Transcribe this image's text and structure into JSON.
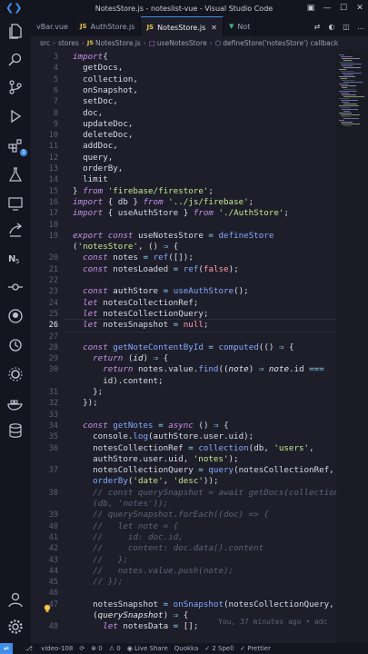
{
  "window": {
    "title": "NotesStore.js - noteslist-vue - Visual Studio Code"
  },
  "activity": {
    "source_control_badge": "1"
  },
  "tabs": [
    {
      "label": "vBar.vue",
      "active": false
    },
    {
      "label": "AuthStore.js",
      "active": false
    },
    {
      "label": "NotesStore.js",
      "active": true
    },
    {
      "label": "Not",
      "active": false
    }
  ],
  "breadcrumb": [
    "src",
    "stores",
    "NotesStore.js",
    "useNotesStore",
    "defineStore('notesStore') callback"
  ],
  "editor": {
    "current_line": 26,
    "lines": [
      {
        "n": "3",
        "segs": [
          [
            "kw",
            "import"
          ],
          [
            "",
            "{"
          ]
        ]
      },
      {
        "n": "4",
        "segs": [
          [
            "",
            "  getDocs,"
          ]
        ]
      },
      {
        "n": "5",
        "segs": [
          [
            "",
            "  collection,"
          ]
        ]
      },
      {
        "n": "6",
        "segs": [
          [
            "",
            "  onSnapshot,"
          ]
        ]
      },
      {
        "n": "7",
        "segs": [
          [
            "",
            "  setDoc,"
          ]
        ]
      },
      {
        "n": "8",
        "segs": [
          [
            "",
            "  doc,"
          ]
        ]
      },
      {
        "n": "9",
        "segs": [
          [
            "",
            "  updateDoc,"
          ]
        ]
      },
      {
        "n": "10",
        "segs": [
          [
            "",
            "  deleteDoc,"
          ]
        ]
      },
      {
        "n": "11",
        "segs": [
          [
            "",
            "  addDoc,"
          ]
        ]
      },
      {
        "n": "12",
        "segs": [
          [
            "",
            "  query,"
          ]
        ]
      },
      {
        "n": "13",
        "segs": [
          [
            "",
            "  orderBy,"
          ]
        ]
      },
      {
        "n": "14",
        "segs": [
          [
            "",
            "  limit"
          ]
        ]
      },
      {
        "n": "15",
        "segs": [
          [
            "",
            "} "
          ],
          [
            "kw",
            "from"
          ],
          [
            "",
            " "
          ],
          [
            "str",
            "'firebase/firestore'"
          ],
          [
            "",
            ";"
          ]
        ]
      },
      {
        "n": "16",
        "segs": [
          [
            "kw",
            "import"
          ],
          [
            "",
            " { db } "
          ],
          [
            "kw",
            "from"
          ],
          [
            "",
            " "
          ],
          [
            "str",
            "'../js/firebase'"
          ],
          [
            "",
            ";"
          ]
        ]
      },
      {
        "n": "17",
        "segs": [
          [
            "kw",
            "import"
          ],
          [
            "",
            " { useAuthStore } "
          ],
          [
            "kw",
            "from"
          ],
          [
            "",
            " "
          ],
          [
            "str",
            "'./AuthStore'"
          ],
          [
            "",
            ";"
          ]
        ]
      },
      {
        "n": "18",
        "segs": []
      },
      {
        "n": "19",
        "segs": [
          [
            "kw",
            "export"
          ],
          [
            "",
            " "
          ],
          [
            "kw",
            "const"
          ],
          [
            "",
            " useNotesStore "
          ],
          [
            "op",
            "="
          ],
          [
            "",
            " "
          ],
          [
            "fn",
            "defineStore"
          ]
        ]
      },
      {
        "n": "",
        "segs": [
          [
            "",
            "("
          ],
          [
            "str",
            "'notesStore'"
          ],
          [
            "",
            ", () "
          ],
          [
            "op",
            "⇒"
          ],
          [
            "",
            " {"
          ]
        ]
      },
      {
        "n": "20",
        "segs": [
          [
            "",
            "  "
          ],
          [
            "kw",
            "const"
          ],
          [
            "",
            " notes "
          ],
          [
            "op",
            "="
          ],
          [
            "",
            " "
          ],
          [
            "fn",
            "ref"
          ],
          [
            "",
            "([]);"
          ]
        ]
      },
      {
        "n": "21",
        "segs": [
          [
            "",
            "  "
          ],
          [
            "kw",
            "const"
          ],
          [
            "",
            " notesLoaded "
          ],
          [
            "op",
            "="
          ],
          [
            "",
            " "
          ],
          [
            "fn",
            "ref"
          ],
          [
            "",
            "("
          ],
          [
            "con",
            "false"
          ],
          [
            "",
            ");"
          ]
        ]
      },
      {
        "n": "22",
        "segs": []
      },
      {
        "n": "23",
        "segs": [
          [
            "",
            "  "
          ],
          [
            "kw",
            "const"
          ],
          [
            "",
            " authStore "
          ],
          [
            "op",
            "="
          ],
          [
            "",
            " "
          ],
          [
            "fn",
            "useAuthStore"
          ],
          [
            "",
            "();"
          ]
        ]
      },
      {
        "n": "24",
        "segs": [
          [
            "",
            "  "
          ],
          [
            "kw",
            "let"
          ],
          [
            "",
            " notesCollectionRef;"
          ]
        ]
      },
      {
        "n": "25",
        "segs": [
          [
            "",
            "  "
          ],
          [
            "kw",
            "let"
          ],
          [
            "",
            " notesCollectionQuery;"
          ]
        ]
      },
      {
        "n": "26",
        "segs": [
          [
            "",
            "  "
          ],
          [
            "kw",
            "let"
          ],
          [
            "",
            " notesSnapshot "
          ],
          [
            "op",
            "="
          ],
          [
            "",
            " "
          ],
          [
            "con",
            "null"
          ],
          [
            "",
            ";"
          ]
        ]
      },
      {
        "n": "27",
        "segs": []
      },
      {
        "n": "28",
        "segs": [
          [
            "",
            "  "
          ],
          [
            "kw",
            "const"
          ],
          [
            "",
            " "
          ],
          [
            "fn",
            "getNoteContentById"
          ],
          [
            "",
            " "
          ],
          [
            "op",
            "="
          ],
          [
            "",
            " "
          ],
          [
            "fn",
            "computed"
          ],
          [
            "",
            "(() "
          ],
          [
            "op",
            "⇒"
          ],
          [
            "",
            " {"
          ]
        ]
      },
      {
        "n": "29",
        "segs": [
          [
            "",
            "    "
          ],
          [
            "ctl",
            "return"
          ],
          [
            "",
            " ("
          ],
          [
            "prm",
            "id"
          ],
          [
            "",
            ") "
          ],
          [
            "op",
            "⇒"
          ],
          [
            "",
            " {"
          ]
        ]
      },
      {
        "n": "30",
        "segs": [
          [
            "",
            "      "
          ],
          [
            "ctl",
            "return"
          ],
          [
            "",
            " notes.value."
          ],
          [
            "fn",
            "find"
          ],
          [
            "",
            "(("
          ],
          [
            "prm",
            "note"
          ],
          [
            "",
            ") "
          ],
          [
            "op",
            "⇒"
          ],
          [
            "",
            " "
          ],
          [
            "prm",
            "note"
          ],
          [
            "",
            ".id "
          ],
          [
            "op",
            "==="
          ]
        ]
      },
      {
        "n": "",
        "segs": [
          [
            "",
            "      id).content;"
          ]
        ]
      },
      {
        "n": "31",
        "segs": [
          [
            "",
            "    };"
          ]
        ]
      },
      {
        "n": "32",
        "segs": [
          [
            "",
            "  });"
          ]
        ]
      },
      {
        "n": "33",
        "segs": []
      },
      {
        "n": "34",
        "segs": [
          [
            "",
            "  "
          ],
          [
            "kw",
            "const"
          ],
          [
            "",
            " "
          ],
          [
            "fn",
            "getNotes"
          ],
          [
            "",
            " "
          ],
          [
            "op",
            "="
          ],
          [
            "",
            " "
          ],
          [
            "kw",
            "async"
          ],
          [
            "",
            " () "
          ],
          [
            "op",
            "⇒"
          ],
          [
            "",
            " {"
          ]
        ]
      },
      {
        "n": "35",
        "segs": [
          [
            "",
            "    console."
          ],
          [
            "fn",
            "log"
          ],
          [
            "",
            "(authStore.user.uid);"
          ]
        ]
      },
      {
        "n": "36",
        "segs": [
          [
            "",
            "    notesCollectionRef "
          ],
          [
            "op",
            "="
          ],
          [
            "",
            " "
          ],
          [
            "fn",
            "collection"
          ],
          [
            "",
            "(db, "
          ],
          [
            "str",
            "'users'"
          ],
          [
            "",
            ","
          ]
        ]
      },
      {
        "n": "",
        "segs": [
          [
            "",
            "    authStore.user.uid, "
          ],
          [
            "str",
            "'notes'"
          ],
          [
            "",
            ");"
          ]
        ]
      },
      {
        "n": "37",
        "segs": [
          [
            "",
            "    notesCollectionQuery "
          ],
          [
            "op",
            "="
          ],
          [
            "",
            " "
          ],
          [
            "fn",
            "query"
          ],
          [
            "",
            "(notesCollectionRef,"
          ]
        ]
      },
      {
        "n": "",
        "segs": [
          [
            "",
            "    "
          ],
          [
            "fn",
            "orderBy"
          ],
          [
            "",
            "("
          ],
          [
            "str",
            "'date'"
          ],
          [
            "",
            ", "
          ],
          [
            "str",
            "'desc'"
          ],
          [
            "",
            "));"
          ]
        ]
      },
      {
        "n": "38",
        "segs": [
          [
            "cm",
            "    // const querySnapshot = await getDocs(collection"
          ]
        ]
      },
      {
        "n": "",
        "segs": [
          [
            "cm",
            "    (db, 'notes'));"
          ]
        ]
      },
      {
        "n": "39",
        "segs": [
          [
            "cm",
            "    // querySnapshot.forEach((doc) => {"
          ]
        ]
      },
      {
        "n": "40",
        "segs": [
          [
            "cm",
            "    //   let note = {"
          ]
        ]
      },
      {
        "n": "41",
        "segs": [
          [
            "cm",
            "    //     id: doc.id,"
          ]
        ]
      },
      {
        "n": "42",
        "segs": [
          [
            "cm",
            "    //     content: doc.data().content"
          ]
        ]
      },
      {
        "n": "43",
        "segs": [
          [
            "cm",
            "    //   };"
          ]
        ]
      },
      {
        "n": "44",
        "segs": [
          [
            "cm",
            "    //   notes.value.push(note);"
          ]
        ]
      },
      {
        "n": "45",
        "segs": [
          [
            "cm",
            "    // });"
          ]
        ]
      },
      {
        "n": "46",
        "segs": []
      },
      {
        "n": "47",
        "segs": [
          [
            "",
            "    notesSnapshot "
          ],
          [
            "op",
            "="
          ],
          [
            "",
            " "
          ],
          [
            "fn",
            "onSnapshot"
          ],
          [
            "",
            "(notesCollectionQuery,"
          ]
        ]
      },
      {
        "n": "",
        "segs": [
          [
            "",
            "    ("
          ],
          [
            "prm",
            "querySnapshot"
          ],
          [
            "",
            ") "
          ],
          [
            "op",
            "⇒"
          ],
          [
            "",
            " {"
          ]
        ]
      },
      {
        "n": "48",
        "segs": [
          [
            "",
            "      "
          ],
          [
            "kw",
            "let"
          ],
          [
            "",
            " notesData "
          ],
          [
            "op",
            "="
          ],
          [
            "",
            " [];"
          ]
        ]
      }
    ],
    "blame": "You, 37 minutes ago • adc"
  },
  "status": {
    "branch": "video-108",
    "sync": "⟳",
    "errors": "⊗ 0",
    "warnings": "⚠ 0",
    "live": "◉ Live Share",
    "quokka": "Quokka",
    "spell": "✓ 2 Spell",
    "prettier": "✓ Prettier"
  },
  "colors": {
    "accent": "#3f8ee8",
    "keyword": "#c792ea",
    "string": "#c3e88d",
    "function": "#82aaff",
    "comment": "#5c6378"
  }
}
